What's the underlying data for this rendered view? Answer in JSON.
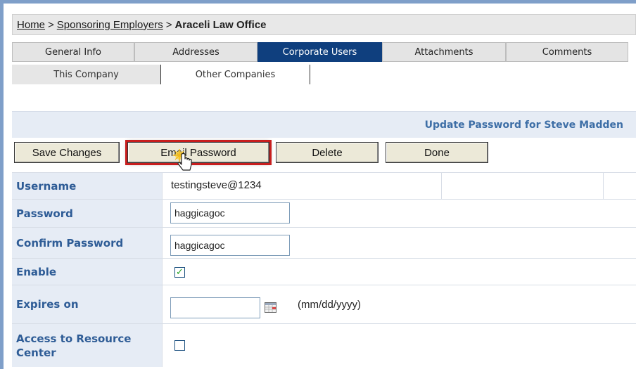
{
  "breadcrumb": {
    "home": "Home",
    "sep1": ">",
    "sponsoring": "Sponsoring Employers",
    "sep2": ">",
    "current": "Araceli Law Office"
  },
  "tabs": [
    {
      "label": "General Info",
      "active": false
    },
    {
      "label": "Addresses",
      "active": false
    },
    {
      "label": "Corporate Users",
      "active": true
    },
    {
      "label": "Attachments",
      "active": false
    },
    {
      "label": "Comments",
      "active": false
    }
  ],
  "subtabs": [
    {
      "label": "This Company"
    },
    {
      "label": "Other Companies"
    }
  ],
  "update_header": "Update Password for Steve Madden",
  "actions": {
    "save": "Save Changes",
    "email": "Email Password",
    "delete": "Delete",
    "done": "Done"
  },
  "form": {
    "username": {
      "label": "Username",
      "value": "testingsteve@1234"
    },
    "password": {
      "label": "Password",
      "value": "haggicagoc"
    },
    "confirm_password": {
      "label": "Confirm Password",
      "value": "haggicagoc"
    },
    "enable": {
      "label": "Enable",
      "checked": true
    },
    "expires_on": {
      "label": "Expires on",
      "value": "",
      "hint": "(mm/dd/yyyy)"
    },
    "resource_center": {
      "label": "Access to Resource Center",
      "checked": false
    }
  },
  "colors": {
    "active_tab": "#0f3f7e",
    "label_text": "#2e5c96",
    "highlight": "#c81e1e"
  }
}
